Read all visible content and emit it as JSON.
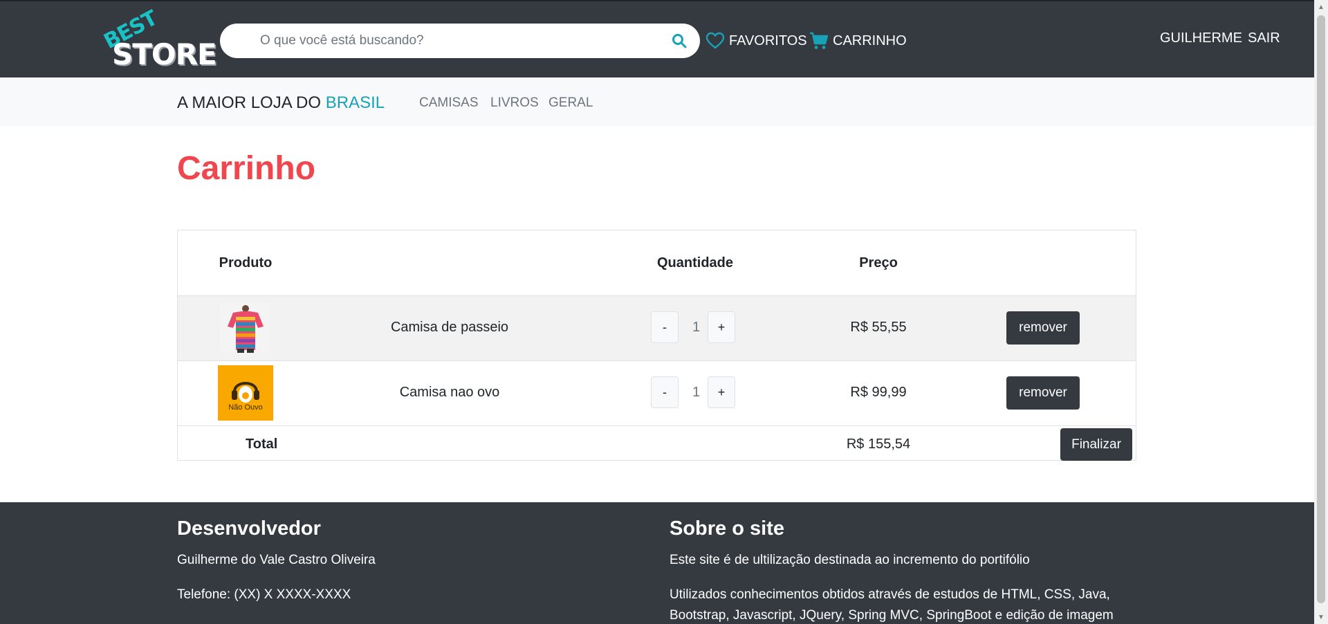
{
  "header": {
    "logo_top": "BEST",
    "logo_bottom": "STORE",
    "search_placeholder": "O que você está buscando?",
    "favorites_label": "FAVORITOS",
    "cart_label": "CARRINHO",
    "user_label": "GUILHERME",
    "logout_label": "SAIR"
  },
  "subnav": {
    "brand_prefix": "A MAIOR LOJA DO",
    "brand_highlight": "BRASIL",
    "categories": [
      "CAMISAS",
      "LIVROS",
      "GERAL"
    ]
  },
  "page": {
    "title": "Carrinho"
  },
  "cart_table": {
    "headers": {
      "product": "Produto",
      "quantity": "Quantidade",
      "price": "Preço"
    },
    "items": [
      {
        "name": "Camisa de passeio",
        "quantity": "1",
        "price": "R$ 55,55",
        "minus": "-",
        "plus": "+",
        "remove": "remover"
      },
      {
        "name": "Camisa nao ovo",
        "quantity": "1",
        "price": "R$ 99,99",
        "minus": "-",
        "plus": "+",
        "remove": "remover",
        "thumb_text": "Não Ouvo"
      }
    ],
    "total_label": "Total",
    "total_value": "R$ 155,54",
    "finish_label": "Finalizar"
  },
  "footer": {
    "dev_title": "Desenvolvedor",
    "dev_name": "Guilherme do Vale Castro Oliveira",
    "dev_phone": "Telefone: (XX) X XXXX-XXXX",
    "about_title": "Sobre o site",
    "about_text1": "Este site é de ultilização destinada ao incremento do portifólio",
    "about_text2": "Utilizados conhecimentos obtidos através de estudos de HTML, CSS, Java, Bootstrap, Javascript, JQuery, Spring MVC, SpringBoot e edição de imagem"
  },
  "colors": {
    "navbar": "#343a40",
    "accent": "#17a2b8",
    "title_red": "#f0474f"
  }
}
